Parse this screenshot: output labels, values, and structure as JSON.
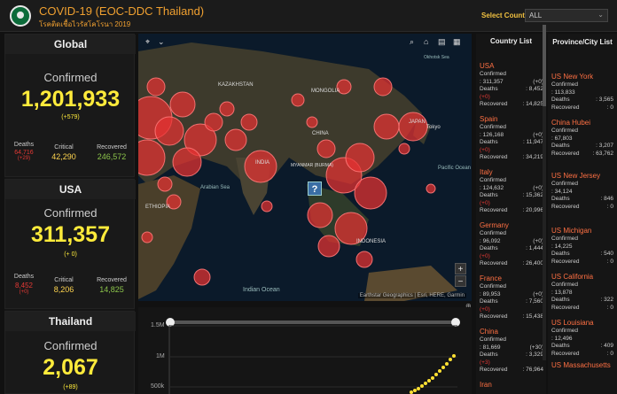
{
  "header": {
    "title": "COVID-19 (EOC-DDC Thailand)",
    "subtitle": "โรคติดเชื้อไวรัสโคโรนา 2019",
    "select_label": "Select Country",
    "select_value": "ALL"
  },
  "global": {
    "title": "Global",
    "confirmed_label": "Confirmed",
    "confirmed": "1,201,933",
    "delta": "(+579)",
    "deaths_label": "Deaths",
    "deaths": "64,716",
    "deaths_delta": "(+29)",
    "critical_label": "Critical",
    "critical": "42,290",
    "recovered_label": "Recovered",
    "recovered": "246,572"
  },
  "usa": {
    "title": "USA",
    "confirmed_label": "Confirmed",
    "confirmed": "311,357",
    "delta": "(+ 0)",
    "deaths_label": "Deaths",
    "deaths": "8,452",
    "deaths_delta": "(+0)",
    "critical_label": "Critical",
    "critical": "8,206",
    "recovered_label": "Recovered",
    "recovered": "14,825"
  },
  "thailand": {
    "title": "Thailand",
    "confirmed_label": "Confirmed",
    "confirmed": "2,067",
    "delta": "(+89)"
  },
  "map": {
    "labels": [
      "KAZAKHSTAN",
      "MONGOLIA",
      "CHINA",
      "JAPAN",
      "Tokyo",
      "INDIA",
      "MYANMAR (BURMA)",
      "INDONESIA",
      "ETHIOPIA",
      "Arabian Sea",
      "Indian Ocean",
      "Pacific Ocean",
      "Okhotsk Sea"
    ],
    "attribution": "Earthstar Geographics | Esri, HERE, Garmin",
    "zoom_in": "+",
    "zoom_out": "−",
    "help": "?"
  },
  "chart": {
    "ticks": [
      "1.5M",
      "1M",
      "500k"
    ]
  },
  "country_list": {
    "title": "Country List",
    "confirmed_label": "Confirmed",
    "deaths_label": "Deaths",
    "recovered_label": "Recovered",
    "items": [
      {
        "name": "USA",
        "confirmed": ": 311,357",
        "confirmed_delta": "(+0)",
        "deaths": ": 8,452",
        "deaths_delta": "(+0)",
        "recovered": ": 14,825"
      },
      {
        "name": "Spain",
        "confirmed": ": 126,168",
        "confirmed_delta": "(+0)",
        "deaths": ": 11,947",
        "deaths_delta": "(+0)",
        "recovered": ": 34,219"
      },
      {
        "name": "Italy",
        "confirmed": ": 124,632",
        "confirmed_delta": "(+0)",
        "deaths": ": 15,362",
        "deaths_delta": "(+0)",
        "recovered": ": 20,996"
      },
      {
        "name": "Germany",
        "confirmed": ": 96,092",
        "confirmed_delta": "(+0)",
        "deaths": ": 1,444",
        "deaths_delta": "(+0)",
        "recovered": ": 26,400"
      },
      {
        "name": "France",
        "confirmed": ": 89,953",
        "confirmed_delta": "(+0)",
        "deaths": ": 7,560",
        "deaths_delta": "(+0)",
        "recovered": ": 15,438"
      },
      {
        "name": "China",
        "confirmed": ": 81,669",
        "confirmed_delta": "(+30)",
        "deaths": ": 3,329",
        "deaths_delta": "(+3)",
        "recovered": ": 76,964"
      },
      {
        "name": "Iran",
        "confirmed": "",
        "confirmed_delta": "",
        "deaths": "",
        "deaths_delta": "",
        "recovered": ""
      }
    ]
  },
  "province_list": {
    "title": "Province/City List",
    "confirmed_label": "Confirmed",
    "deaths_label": "Deaths",
    "recovered_label": "Recovered",
    "items": [
      {
        "name": "US New York",
        "confirmed": ": 113,833",
        "deaths": ": 3,565",
        "recovered": ": 0"
      },
      {
        "name": "China Hubei",
        "confirmed": ": 67,803",
        "deaths": ": 3,207",
        "recovered": ": 63,762"
      },
      {
        "name": "US New Jersey",
        "confirmed": ": 34,124",
        "deaths": ": 846",
        "recovered": ": 0"
      },
      {
        "name": "US Michigan",
        "confirmed": ": 14,225",
        "deaths": ": 540",
        "recovered": ": 0"
      },
      {
        "name": "US California",
        "confirmed": ": 13,878",
        "deaths": ": 322",
        "recovered": ": 0"
      },
      {
        "name": "US Louisiana",
        "confirmed": ": 12,496",
        "deaths": ": 409",
        "recovered": ": 0"
      },
      {
        "name": "US Massachusetts",
        "confirmed": "",
        "deaths": "",
        "recovered": ""
      }
    ]
  }
}
